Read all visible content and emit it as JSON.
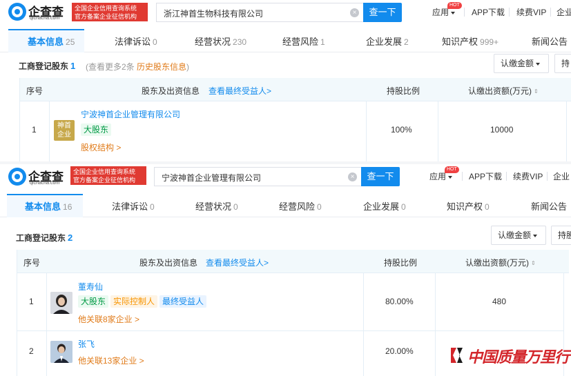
{
  "brand": {
    "logo_cn": "企查查",
    "logo_en": "qichacha.com",
    "badge_line1": "全国企业信用查询系统",
    "badge_line2": "官方备案企业征信机构"
  },
  "nav": {
    "apps": "应用",
    "hot": "HOT",
    "app_download": "APP下载",
    "vip": "续费VIP",
    "enterprise": "企业"
  },
  "search_button": "查一下",
  "panel1": {
    "search_value": "浙江神首生物科技有限公司",
    "tabs": [
      {
        "label": "基本信息",
        "count": "25"
      },
      {
        "label": "法律诉讼",
        "count": "0"
      },
      {
        "label": "经营状况",
        "count": "230"
      },
      {
        "label": "经营风险",
        "count": "1"
      },
      {
        "label": "企业发展",
        "count": "2"
      },
      {
        "label": "知识产权",
        "count": "999+"
      },
      {
        "label": "新闻公告",
        "count": ""
      }
    ],
    "section_title": "工商登记股东",
    "section_count": "1",
    "note_prefix": "(查看更多2条",
    "note_link": "历史股东信息",
    "note_suffix": ")",
    "dropdown": "认缴金额",
    "dropdown2": "持",
    "headers": {
      "no": "序号",
      "holder": "股东及出资信息",
      "holder_link": "查看最终受益人>",
      "ratio": "持股比例",
      "capital": "认缴出资额(万元)"
    },
    "rows": [
      {
        "no": "1",
        "logo_text1": "神首",
        "logo_text2": "企业",
        "name": "宁波神首企业管理有限公司",
        "tags": [
          "大股东"
        ],
        "link": "股权结构 >",
        "ratio": "100%",
        "capital": "10000"
      }
    ]
  },
  "panel2": {
    "search_value": "宁波神首企业管理有限公司",
    "tabs": [
      {
        "label": "基本信息",
        "count": "16"
      },
      {
        "label": "法律诉讼",
        "count": "0"
      },
      {
        "label": "经营状况",
        "count": "0"
      },
      {
        "label": "经营风险",
        "count": "0"
      },
      {
        "label": "企业发展",
        "count": "0"
      },
      {
        "label": "知识产权",
        "count": "0"
      },
      {
        "label": "新闻公告",
        "count": ""
      }
    ],
    "section_title": "工商登记股东",
    "section_count": "2",
    "dropdown": "认缴金额",
    "dropdown2": "持股",
    "headers": {
      "no": "序号",
      "holder": "股东及出资信息",
      "holder_link": "查看最终受益人>",
      "ratio": "持股比例",
      "capital": "认缴出资额(万元)"
    },
    "rows": [
      {
        "no": "1",
        "name": "董寿仙",
        "tags": [
          "大股东",
          "实际控制人",
          "最终受益人"
        ],
        "link": "他关联8家企业 >",
        "ratio": "80.00%",
        "capital": "480"
      },
      {
        "no": "2",
        "name": "张飞",
        "tags": [],
        "link": "他关联13家企业 >",
        "ratio": "20.00%",
        "capital": ""
      }
    ]
  },
  "watermark": "中国质量万里行",
  "colors": {
    "primary": "#128bed",
    "badge_red": "#e03a32",
    "orange": "#e07b1a",
    "tag_green": "#009944",
    "tag_orange": "#f79400",
    "watermark_red": "#d3262b"
  }
}
